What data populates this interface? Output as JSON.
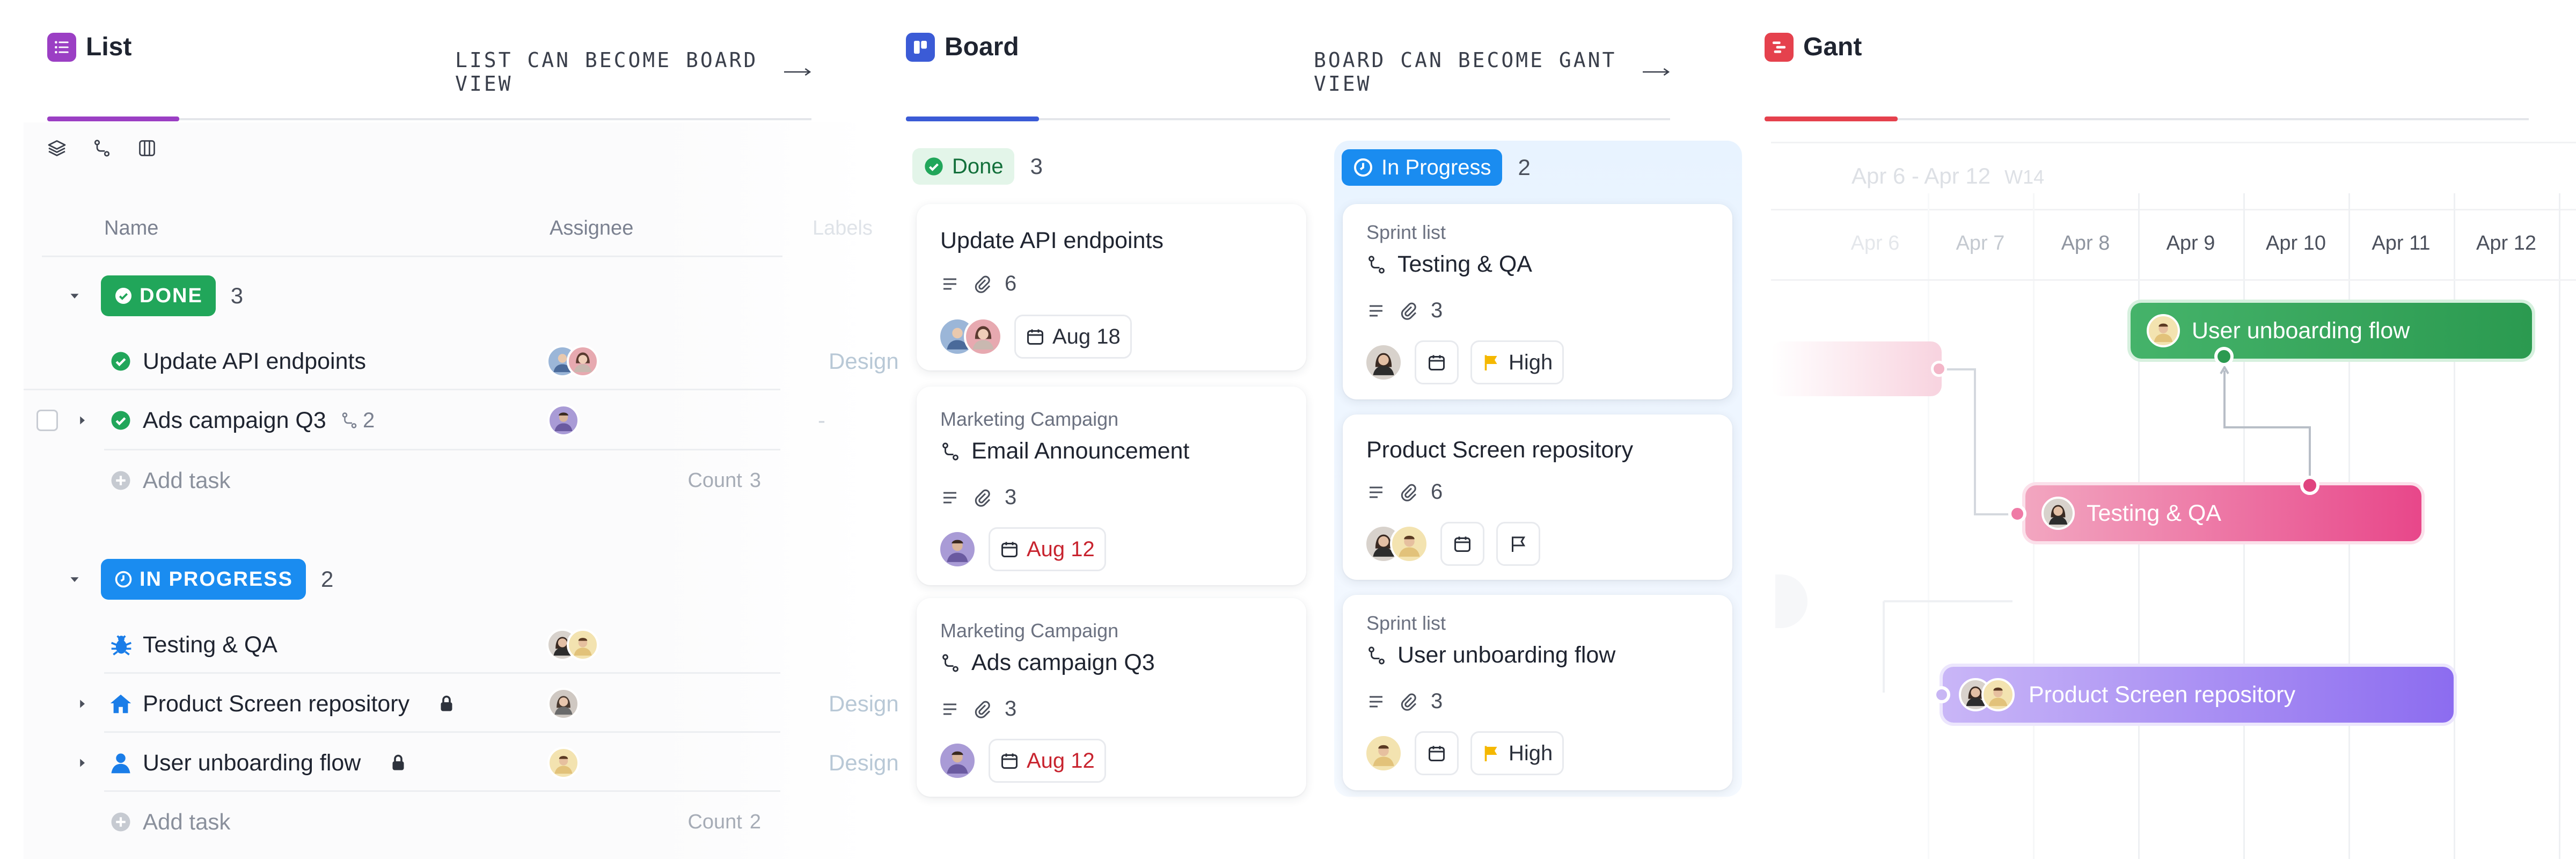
{
  "sections": {
    "list": {
      "title": "List",
      "hint": "LIST CAN BECOME BOARD VIEW",
      "accent": "#9b3fc4"
    },
    "board": {
      "title": "Board",
      "hint": "BOARD CAN BECOME GANT VIEW",
      "accent": "#3b5bd6"
    },
    "gant": {
      "title": "Gant",
      "accent": "#e5414d"
    }
  },
  "list": {
    "columns": {
      "name": "Name",
      "assignee": "Assignee",
      "labels": "Labels"
    },
    "groups": [
      {
        "status": "DONE",
        "count": "3",
        "color": "#21a65a",
        "tasks": [
          {
            "name": "Update API endpoints",
            "label": "Design"
          },
          {
            "name": "Ads campaign Q3",
            "subtasks": "2",
            "label": "-"
          }
        ],
        "add_task": "Add task",
        "count_label": "Count",
        "count_value": "3"
      },
      {
        "status": "IN PROGRESS",
        "count": "2",
        "color": "#1a8cf0",
        "tasks": [
          {
            "name": "Testing & QA",
            "label": ""
          },
          {
            "name": "Product Screen repository",
            "label": "Design"
          },
          {
            "name": "User unboarding flow",
            "label": "Design"
          }
        ],
        "add_task": "Add task",
        "count_label": "Count",
        "count_value": "2"
      }
    ]
  },
  "board": {
    "columns": [
      {
        "status": "Done",
        "count": "3",
        "cards": [
          {
            "title": "Update API endpoints",
            "attachments": "6",
            "date": "Aug 18"
          },
          {
            "list": "Marketing Campaign",
            "title": "Email Announcement",
            "attachments": "3",
            "date": "Aug 12"
          },
          {
            "list": "Marketing Campaign",
            "title": "Ads campaign Q3",
            "attachments": "3",
            "date": "Aug 12"
          }
        ]
      },
      {
        "status": "In Progress",
        "count": "2",
        "cards": [
          {
            "list": "Sprint list",
            "title": "Testing & QA",
            "attachments": "3",
            "priority": "High"
          },
          {
            "title": "Product Screen repository",
            "attachments": "6"
          },
          {
            "list": "Sprint list",
            "title": "User unboarding flow",
            "attachments": "3",
            "priority": "High"
          }
        ]
      }
    ]
  },
  "gant": {
    "range": "Apr 6 - Apr 12",
    "week": "W14",
    "days": [
      "Apr 6",
      "Apr 7",
      "Apr 8",
      "Apr 9",
      "Apr 10",
      "Apr 11",
      "Apr 12"
    ],
    "bars": [
      {
        "name": "User unboarding flow",
        "color": "#2f9e56"
      },
      {
        "name": "Testing & QA",
        "color": "#e84b8a"
      },
      {
        "name": "Product Screen repository",
        "color": "#8a6cf0"
      }
    ]
  }
}
